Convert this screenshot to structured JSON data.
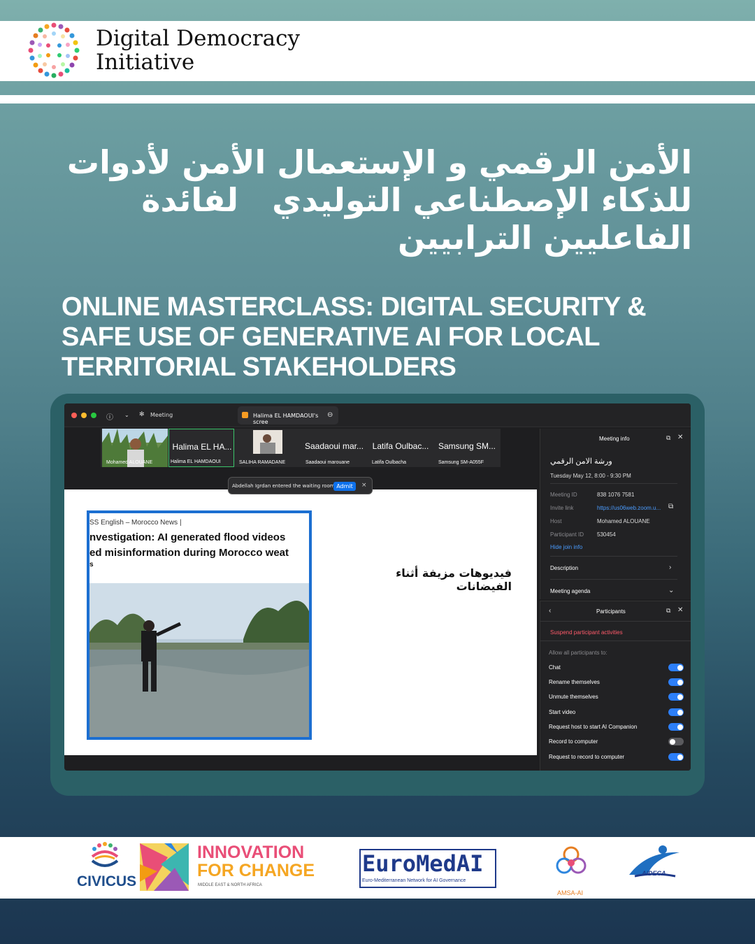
{
  "header": {
    "brand_line1": "Digital Democracy",
    "brand_line2": "Initiative"
  },
  "titles": {
    "arabic_lines": [
      "الأمن الرقمي و الإستعمال الأمن لأدوات",
      "للذكاء الإصطناعي التوليدي   لفائدة",
      "الفاعليين الترابيين"
    ],
    "english_lines": [
      "ONLINE MASTERCLASS: DIGITAL SECURITY &",
      "SAFE USE OF GENERATIVE AI FOR LOCAL",
      "TERRITORIAL STAKEHOLDERS"
    ]
  },
  "zoom": {
    "titlebar": {
      "meeting_label": "Meeting",
      "share_tab_label": "Halima EL HAMDAOUI's scree"
    },
    "participants_strip": [
      {
        "big": "",
        "small": "Mohamed ALOUANE",
        "video": true
      },
      {
        "big": "Halima EL HA...",
        "small": "Halima EL HAMDAOUI",
        "video": false
      },
      {
        "big": "",
        "small": "SALIHA RAMADANE",
        "video": true
      },
      {
        "big": "Saadaoui mar...",
        "small": "Saadaoui marouane",
        "video": false
      },
      {
        "big": "Latifa Oulbac...",
        "small": "Latifa Oulbacha",
        "video": false
      },
      {
        "big": "Samsung SM...",
        "small": "Samsung SM-A055F",
        "video": false
      }
    ],
    "toast": {
      "message": "Abdellah Igrdan entered the waiting room",
      "admit": "Admit",
      "close": "×"
    },
    "slide": {
      "article_source": "SS English – Morocco News  |",
      "article_headline_1": "nvestigation: AI generated flood videos",
      "article_headline_2": "ed misinformation during Morocco weat",
      "article_headline_3": "s",
      "arabic_caption": "فيديوهات مزيفة أثناء الفيضانات"
    },
    "meeting_info": {
      "panel_title": "Meeting info",
      "meeting_name": "ورشة الامن الرقمي",
      "date_time": "Tuesday May 12, 8:00 - 9:30 PM",
      "rows": [
        {
          "label": "Meeting ID",
          "value": "838 1076 7581"
        },
        {
          "label": "Invite link",
          "value": "https://us06web.zoom.u..."
        },
        {
          "label": "Host",
          "value": "Mohamed ALOUANE"
        },
        {
          "label": "Participant ID",
          "value": "530454"
        }
      ],
      "hide_join": "Hide join info",
      "description": "Description",
      "agenda": "Meeting agenda"
    },
    "participants_panel": {
      "title": "Participants",
      "suspend": "Suspend participant activities",
      "allow_heading": "Allow all participants to:",
      "toggles": [
        {
          "label": "Chat",
          "on": true
        },
        {
          "label": "Rename themselves",
          "on": true
        },
        {
          "label": "Unmute themselves",
          "on": true
        },
        {
          "label": "Start video",
          "on": true
        },
        {
          "label": "Request host to start AI Companion",
          "on": true
        },
        {
          "label": "Record to computer",
          "on": false
        },
        {
          "label": "Request to record to computer",
          "on": true
        }
      ]
    }
  },
  "footer": {
    "civicus": "CIVICUS",
    "innovation_1": "INNOVATION",
    "innovation_2": "FOR CHANGE",
    "innovation_sub": "MIDDLE EAST & NORTH AFRICA",
    "euromed": "EuroMedAI",
    "euromed_sub": "Euro-Mediterranean Network for AI Governance",
    "amsa": "AMSA-AI",
    "aideca": "AIDECA"
  },
  "colors": {
    "zoom_blue": "#0e71eb",
    "toggle_on": "#2d7ff9",
    "frame_teal": "#2b6066",
    "article_border": "#1c6fd1"
  }
}
